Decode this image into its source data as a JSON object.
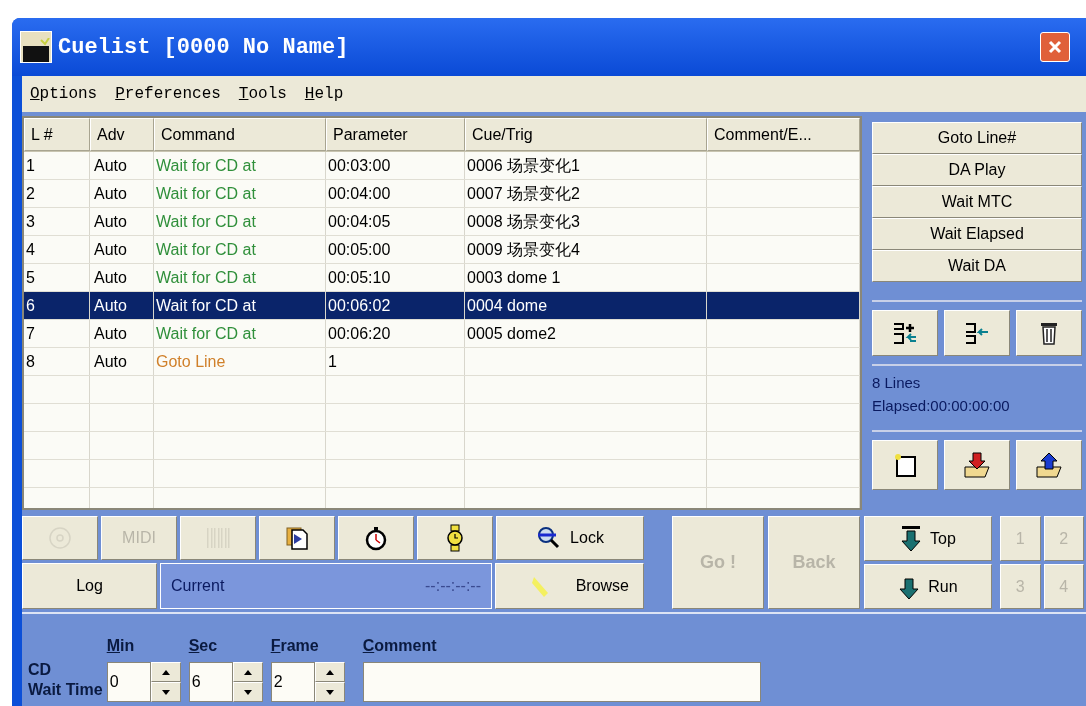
{
  "window": {
    "title": "Cuelist [0000 No Name]"
  },
  "menu": [
    {
      "label": "Options",
      "mnemonic": true
    },
    {
      "label": "Preferences",
      "mnemonic": true
    },
    {
      "label": "Tools",
      "mnemonic": true
    },
    {
      "label": "Help",
      "mnemonic": true
    }
  ],
  "table": {
    "columns": [
      "L #",
      "Adv",
      "Command",
      "Parameter",
      "Cue/Trig",
      "Comment/E..."
    ],
    "rows": [
      {
        "line": "1",
        "adv": "Auto",
        "command": "Wait for CD at",
        "kind": "wait",
        "parameter": "00:03:00",
        "cue": "0006 场景变化1",
        "selected": false
      },
      {
        "line": "2",
        "adv": "Auto",
        "command": "Wait for CD at",
        "kind": "wait",
        "parameter": "00:04:00",
        "cue": "0007 场景变化2",
        "selected": false
      },
      {
        "line": "3",
        "adv": "Auto",
        "command": "Wait for CD at",
        "kind": "wait",
        "parameter": "00:04:05",
        "cue": "0008 场景变化3",
        "selected": false
      },
      {
        "line": "4",
        "adv": "Auto",
        "command": "Wait for CD at",
        "kind": "wait",
        "parameter": "00:05:00",
        "cue": "0009 场景变化4",
        "selected": false
      },
      {
        "line": "5",
        "adv": "Auto",
        "command": "Wait for CD at",
        "kind": "wait",
        "parameter": "00:05:10",
        "cue": "0003 dome 1",
        "selected": false
      },
      {
        "line": "6",
        "adv": "Auto",
        "command": "Wait for CD at",
        "kind": "wait",
        "parameter": "00:06:02",
        "cue": "0004 dome",
        "selected": true
      },
      {
        "line": "7",
        "adv": "Auto",
        "command": "Wait for CD at",
        "kind": "wait",
        "parameter": "00:06:20",
        "cue": "0005 dome2",
        "selected": false
      },
      {
        "line": "8",
        "adv": "Auto",
        "command": "Goto Line",
        "kind": "goto",
        "parameter": "1",
        "selected": false
      }
    ]
  },
  "command_buttons": [
    "Goto Line#",
    "DA Play",
    "Wait MTC",
    "Wait Elapsed",
    "Wait DA"
  ],
  "status": {
    "lines": "8 Lines",
    "elapsed": "Elapsed:00:00:00:00"
  },
  "toolbar": {
    "tools": [
      {
        "kind": "cd",
        "disabled": true
      },
      {
        "kind": "midi",
        "label": "MIDI",
        "disabled": true
      },
      {
        "kind": "barcode",
        "disabled": true
      },
      {
        "kind": "play",
        "disabled": false
      },
      {
        "kind": "stopwatch",
        "disabled": false
      },
      {
        "kind": "watch",
        "disabled": false
      }
    ],
    "lock": "Lock",
    "log": "Log",
    "current": {
      "label": "Current",
      "time": "--:--:--:--"
    },
    "browse": "Browse",
    "go": {
      "label": "Go !",
      "disabled": true
    },
    "back": {
      "label": "Back",
      "disabled": true
    },
    "top": "Top",
    "run": "Run",
    "presets": [
      {
        "label": "1",
        "disabled": true
      },
      {
        "label": "2",
        "disabled": true
      },
      {
        "label": "3",
        "disabled": true
      },
      {
        "label": "4",
        "disabled": true
      }
    ]
  },
  "wait_time": {
    "label_lines": [
      "CD",
      "Wait Time"
    ],
    "fields": [
      {
        "label": "Min",
        "mnemonic": true,
        "value": "0"
      },
      {
        "label": "Sec",
        "mnemonic": true,
        "value": "6"
      },
      {
        "label": "Frame",
        "mnemonic": true,
        "value": "2"
      }
    ],
    "comment": {
      "label": "Comment",
      "mnemonic": true
    }
  }
}
